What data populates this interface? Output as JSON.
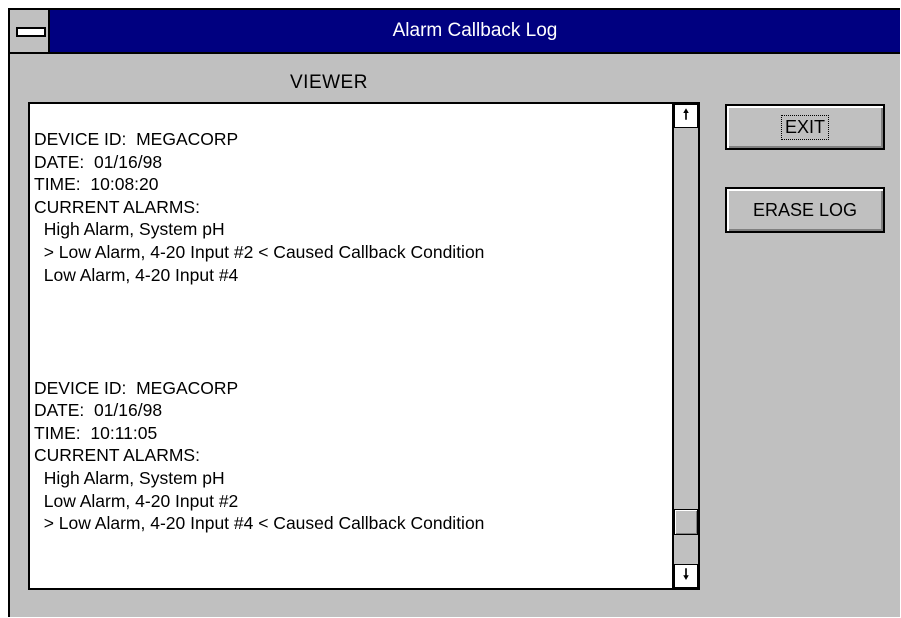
{
  "window": {
    "title": "Alarm Callback Log"
  },
  "viewer": {
    "label": "VIEWER",
    "log_lines": [
      "DEVICE ID:  MEGACORP",
      "DATE:  01/16/98",
      "TIME:  10:08:20",
      "CURRENT ALARMS:",
      "  High Alarm, System pH",
      "  > Low Alarm, 4-20 Input #2 < Caused Callback Condition",
      "  Low Alarm, 4-20 Input #4",
      "",
      "",
      "",
      "",
      "DEVICE ID:  MEGACORP",
      "DATE:  01/16/98",
      "TIME:  10:11:05",
      "CURRENT ALARMS:",
      "  High Alarm, System pH",
      "  Low Alarm, 4-20 Input #2",
      "  > Low Alarm, 4-20 Input #4 < Caused Callback Condition"
    ],
    "scroll_position": 0.93
  },
  "buttons": {
    "exit_label": "EXIT",
    "erase_label": "ERASE LOG"
  },
  "icons": {
    "system_menu": "system-menu-icon",
    "scroll_up": "up-arrow-icon",
    "scroll_down": "down-arrow-icon"
  },
  "colors": {
    "titlebar": "#000080",
    "face": "#c0c0c0"
  }
}
